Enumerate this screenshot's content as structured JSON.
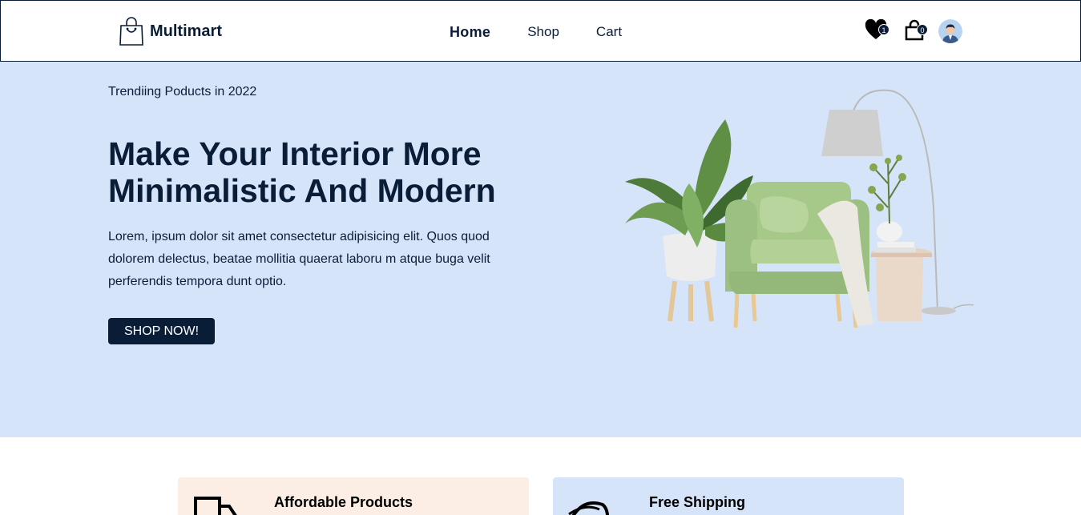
{
  "header": {
    "brand": "Multimart",
    "nav": [
      {
        "label": "Home",
        "active": true
      },
      {
        "label": "Shop",
        "active": false
      },
      {
        "label": "Cart",
        "active": false
      }
    ],
    "wishlist_count": "1",
    "cart_count": "0",
    "icons": [
      "shopping-bag-icon",
      "heart-icon",
      "cart-bag-icon",
      "user-avatar"
    ]
  },
  "hero": {
    "subtitle": "Trendiing Poducts in 2022",
    "title": "Make Your Interior More Minimalistic And Modern",
    "description": "Lorem, ipsum dolor sit amet consectetur adipisicing elit. Quos quod dolorem delectus, beatae mollitia quaerat laboru m atque buga velit perferendis tempora dunt optio.",
    "button": "SHOP NOW!"
  },
  "services": [
    {
      "title": "Affordable Products",
      "icon": "truck-icon",
      "bg": "#fceee5"
    },
    {
      "title": "Free Shipping",
      "icon": "refresh-icon",
      "bg": "#d6e4fa"
    }
  ],
  "colors": {
    "primary": "#0a1d37",
    "hero_bg": "#d6e4fa",
    "card_peach": "#fceee5"
  }
}
